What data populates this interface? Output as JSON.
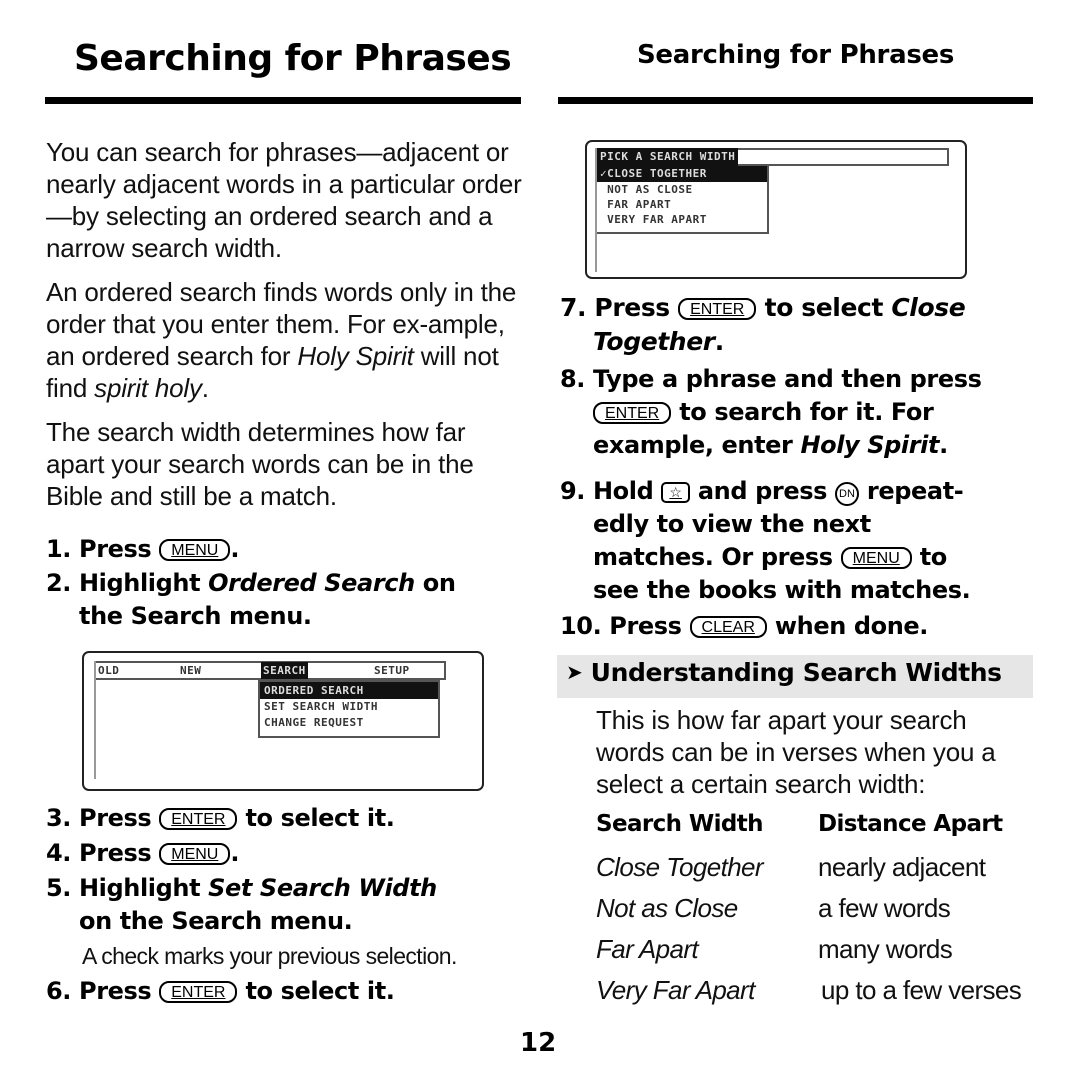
{
  "page": {
    "number": "12"
  },
  "left": {
    "title": "Searching for Phrases",
    "paragraphs": [
      {
        "text": "You can search for phrases—adjacent or nearly adjacent words in a particular order—by selecting an ordered search and a narrow search width."
      },
      {
        "parts": [
          "An ordered search finds words only in the order that you enter them. For ex-ample, an ordered search for ",
          "Holy Spirit",
          " will not find ",
          "spirit holy",
          "."
        ]
      },
      {
        "text": "The search width determines how far apart your search words can be in the Bible and still be a match."
      }
    ],
    "steps": [
      {
        "num": "1.",
        "pre": "Press",
        "key": "MENU",
        "post": "."
      },
      {
        "num": "2.",
        "pre": "Highlight",
        "italic": "Ordered Search",
        "post": "on",
        "cont": "the Search menu."
      },
      {
        "num": "3.",
        "pre": "Press",
        "key": "ENTER",
        "post": "to select it."
      },
      {
        "num": "4.",
        "pre": "Press",
        "key": "MENU",
        "post": "."
      },
      {
        "num": "5.",
        "pre": "Highlight",
        "italic": "Set Search Width",
        "cont": "on the Search menu."
      },
      {
        "num": "6.",
        "pre": "Press",
        "key": "ENTER",
        "post": "to select it."
      }
    ],
    "note": "A check marks your previous selection.",
    "screen": {
      "menu_bar": [
        "OLD",
        "NEW",
        "SEARCH",
        "SETUP"
      ],
      "selected_menu": "SEARCH",
      "dropdown": [
        "ORDERED SEARCH",
        "SET SEARCH WIDTH",
        "CHANGE REQUEST"
      ],
      "selected_item": "ORDERED SEARCH"
    }
  },
  "right": {
    "title": "Searching for Phrases",
    "screen": {
      "prompt": "PICK A SEARCH WIDTH",
      "options": [
        "✓CLOSE TOGETHER",
        " NOT AS CLOSE",
        " FAR APART",
        " VERY FAR APART"
      ],
      "selected_item": "✓CLOSE TOGETHER"
    },
    "steps": [
      {
        "num": "7.",
        "pre": "Press",
        "key": "ENTER",
        "post": "to select",
        "italic": "Close",
        "cont_italic": "Together",
        "cont_post": "."
      },
      {
        "num": "8.",
        "pre": "Type a phrase and then press",
        "key": "ENTER",
        "cont_post": "to search for it. For",
        "cont2_pre": "example, enter",
        "cont2_italic": "Holy Spirit",
        "cont2_post": "."
      },
      {
        "num": "9.",
        "pre": "Hold",
        "key_star": "☆",
        "mid": "and press",
        "key_dn": "DN",
        "post": "repeat-",
        "cont": "edly to view the next",
        "cont2_pre": "matches. Or press",
        "key": "MENU",
        "cont2_post": "to",
        "cont3": "see the books with matches."
      },
      {
        "num": "10.",
        "pre": "Press",
        "key": "CLEAR",
        "post": "when done."
      }
    ],
    "section": {
      "icon": "arrow-right-icon",
      "arrow": "➤",
      "title": "Understanding Search Widths",
      "intro": "This is how far apart your search words can be in verses when you a select a certain search width:"
    },
    "table": {
      "headers": [
        "Search Width",
        "Distance Apart"
      ],
      "rows": [
        [
          "Close Together",
          "nearly adjacent"
        ],
        [
          "Not as Close",
          "a few words"
        ],
        [
          "Far Apart",
          "many words"
        ],
        [
          "Very Far Apart",
          "up to a few verses"
        ]
      ]
    }
  }
}
